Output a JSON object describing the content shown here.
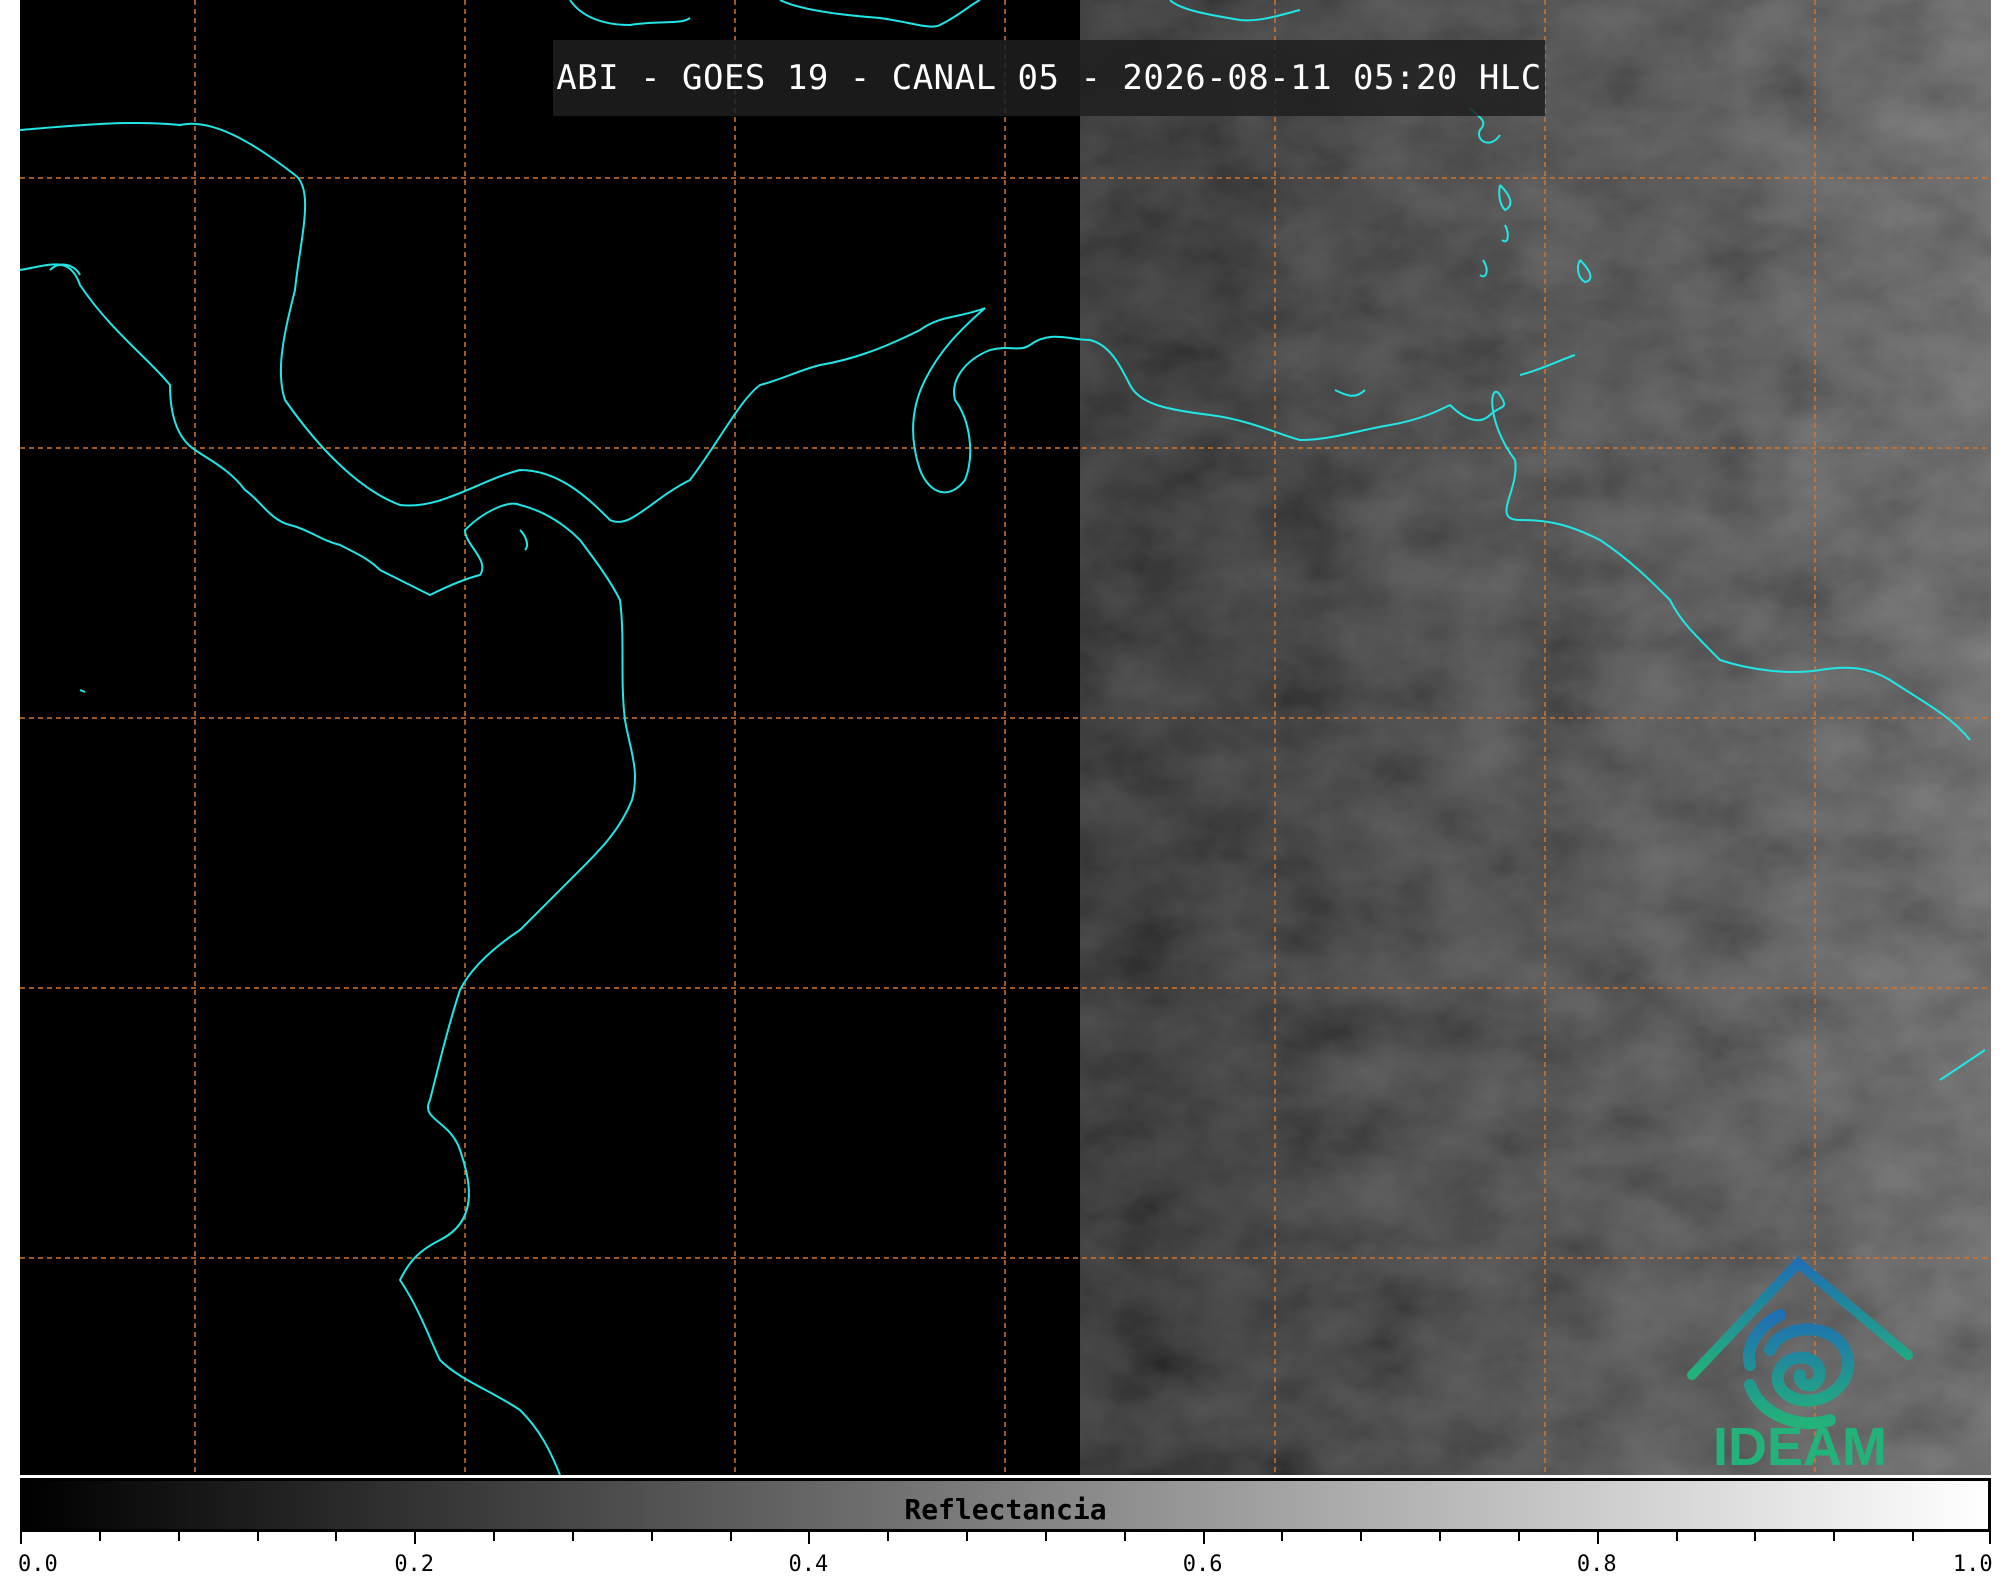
{
  "title": "ABI - GOES 19 - CANAL 05 - 2026-08-11 05:20 HLC",
  "logo": {
    "text": "IDEAM",
    "color": "#23b27a",
    "accent": "#1f6fb3"
  },
  "colorbar": {
    "label": "Reflectancia",
    "colormap": "grayscale",
    "range": [
      0.0,
      1.0
    ],
    "tick_labels": [
      "0.0",
      "0.2",
      "0.4",
      "0.6",
      "0.8",
      "1.0"
    ],
    "minor_ticks_per_interval": 4
  },
  "map": {
    "coastline_color": "#22e5e5",
    "grid_color": "#d2742a",
    "grid_style": "dashed",
    "background": "#000000"
  }
}
